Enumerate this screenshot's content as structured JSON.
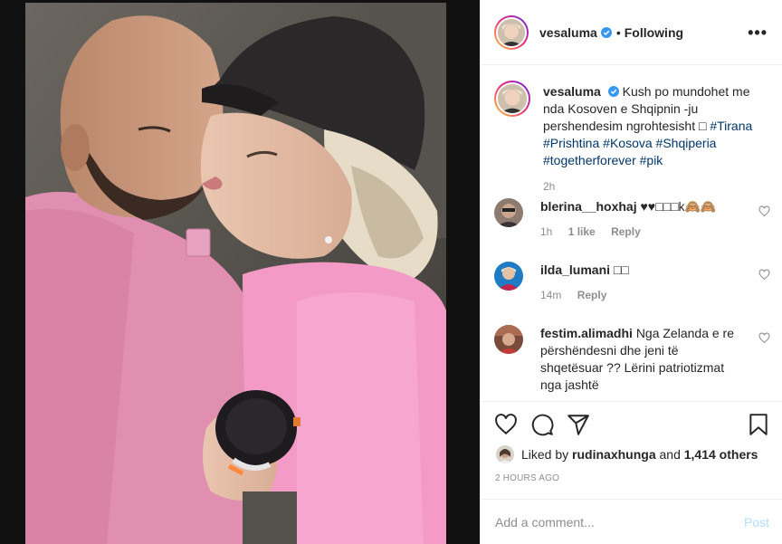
{
  "post": {
    "username": "vesaluma",
    "follow_status": "Following",
    "more_label": "•••"
  },
  "caption": {
    "username": "vesaluma",
    "text": "Kush po mundohet me nda Kosoven e Shqipnin -ju pershendesim ngrohtesisht □",
    "hashtags": [
      "#Tirana",
      "#Prishtina",
      "#Kosova",
      "#Shqiperia",
      "#togetherforever",
      "#pik"
    ],
    "time": "2h"
  },
  "comments": [
    {
      "username": "blerina__hoxhaj",
      "text": "♥♥□□□k🙈🙈",
      "time": "1h",
      "likes": "1 like",
      "reply": "Reply"
    },
    {
      "username": "ilda_lumani",
      "text": "□□",
      "time": "14m",
      "likes": "",
      "reply": "Reply"
    },
    {
      "username": "festim.alimadhi",
      "text": "Nga Zelanda e re përshëndesni dhe jeni të shqetësuar ?? Lërini patriotizmat nga jashtë",
      "time": "",
      "likes": "",
      "reply": ""
    }
  ],
  "likes": {
    "prefix": "Liked by",
    "user": "rudinaxhunga",
    "joiner": "and",
    "others": "1,414 others"
  },
  "timestamp": "2 HOURS AGO",
  "add_comment": {
    "placeholder": "Add a comment...",
    "post_label": "Post"
  },
  "icons": [
    "heart-icon",
    "comment-icon",
    "share-icon",
    "bookmark-icon",
    "verified-icon",
    "more-icon"
  ],
  "colors": {
    "link": "#00376b",
    "muted": "#8e8e8e",
    "post_button": "#b2dffc",
    "verified": "#3897f0"
  }
}
